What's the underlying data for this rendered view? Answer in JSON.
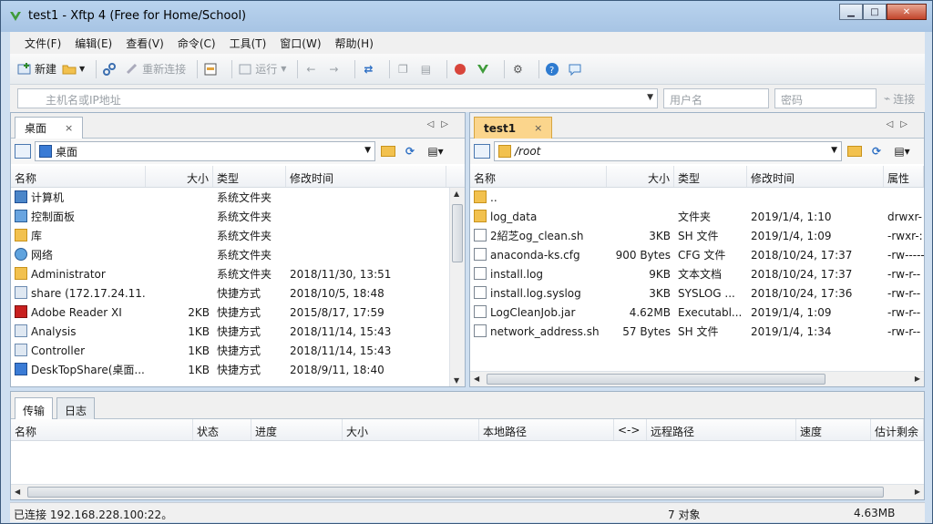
{
  "window": {
    "title": "test1 - Xftp 4 (Free for Home/School)",
    "min_glyph": "▁",
    "max_glyph": "□",
    "close_glyph": "✕"
  },
  "menu": [
    "文件(F)",
    "编辑(E)",
    "查看(V)",
    "命令(C)",
    "工具(T)",
    "窗口(W)",
    "帮助(H)"
  ],
  "toolbar": {
    "new_label": "新建",
    "reconnect_label": "重新连接",
    "run_label": "运行"
  },
  "address": {
    "host_placeholder": "主机名或IP地址",
    "user_placeholder": "用户名",
    "password_placeholder": "密码",
    "connect_label": "连接"
  },
  "left_pane": {
    "tab_label": "桌面",
    "tab_close": "×",
    "path": "桌面",
    "columns": [
      "名称",
      "大小",
      "类型",
      "修改时间"
    ],
    "rows": [
      {
        "name": "计算机",
        "size": "",
        "type": "系统文件夹",
        "modified": "",
        "icon": "computer-icon"
      },
      {
        "name": "控制面板",
        "size": "",
        "type": "系统文件夹",
        "modified": "",
        "icon": "control-panel-icon"
      },
      {
        "name": "库",
        "size": "",
        "type": "系统文件夹",
        "modified": "",
        "icon": "library-icon"
      },
      {
        "name": "网络",
        "size": "",
        "type": "系统文件夹",
        "modified": "",
        "icon": "network-icon"
      },
      {
        "name": "Administrator",
        "size": "",
        "type": "系统文件夹",
        "modified": "2018/11/30, 13:51",
        "icon": "user-folder-icon"
      },
      {
        "name": "share (172.17.24.11...",
        "size": "",
        "type": "快捷方式",
        "modified": "2018/10/5, 18:48",
        "icon": "shortcut-icon"
      },
      {
        "name": "Adobe Reader XI",
        "size": "2KB",
        "type": "快捷方式",
        "modified": "2015/8/17, 17:59",
        "icon": "adobe-icon"
      },
      {
        "name": "Analysis",
        "size": "1KB",
        "type": "快捷方式",
        "modified": "2018/11/14, 15:43",
        "icon": "shortcut-icon"
      },
      {
        "name": "Controller",
        "size": "1KB",
        "type": "快捷方式",
        "modified": "2018/11/14, 15:43",
        "icon": "shortcut-icon"
      },
      {
        "name": "DeskTopShare(桌面...",
        "size": "1KB",
        "type": "快捷方式",
        "modified": "2018/9/11, 18:40",
        "icon": "desktop-share-icon"
      }
    ]
  },
  "right_pane": {
    "tab_label": "test1",
    "tab_close": "×",
    "path": "/root",
    "columns": [
      "名称",
      "大小",
      "类型",
      "修改时间",
      "属性"
    ],
    "rows": [
      {
        "name": "..",
        "size": "",
        "type": "",
        "modified": "",
        "attr": "",
        "icon": "folder-up-icon"
      },
      {
        "name": "log_data",
        "size": "",
        "type": "文件夹",
        "modified": "2019/1/4, 1:10",
        "attr": "drwxr-",
        "icon": "folder-icon"
      },
      {
        "name": "2紹芝og_clean.sh",
        "size": "3KB",
        "type": "SH 文件",
        "modified": "2019/1/4, 1:09",
        "attr": "-rwxr-:",
        "icon": "file-icon"
      },
      {
        "name": "anaconda-ks.cfg",
        "size": "900 Bytes",
        "type": "CFG 文件",
        "modified": "2018/10/24, 17:37",
        "attr": "-rw-----",
        "icon": "file-icon"
      },
      {
        "name": "install.log",
        "size": "9KB",
        "type": "文本文档",
        "modified": "2018/10/24, 17:37",
        "attr": "-rw-r--",
        "icon": "file-icon"
      },
      {
        "name": "install.log.syslog",
        "size": "3KB",
        "type": "SYSLOG ...",
        "modified": "2018/10/24, 17:36",
        "attr": "-rw-r--",
        "icon": "file-icon"
      },
      {
        "name": "LogCleanJob.jar",
        "size": "4.62MB",
        "type": "Executabl...",
        "modified": "2019/1/4, 1:09",
        "attr": "-rw-r--",
        "icon": "jar-icon"
      },
      {
        "name": "network_address.sh",
        "size": "57 Bytes",
        "type": "SH 文件",
        "modified": "2019/1/4, 1:34",
        "attr": "-rw-r--",
        "icon": "file-icon"
      }
    ]
  },
  "transfer": {
    "tabs": [
      "传输",
      "日志"
    ],
    "columns": [
      "名称",
      "状态",
      "进度",
      "大小",
      "本地路径",
      "<->",
      "远程路径",
      "速度",
      "估计剩余"
    ]
  },
  "status": {
    "connection": "已连接 192.168.228.100:22。",
    "objects": "7 对象",
    "size": "4.63MB"
  },
  "colors": {
    "active_tab": "#fbd58c",
    "title_bar": "#b9d3ee"
  }
}
